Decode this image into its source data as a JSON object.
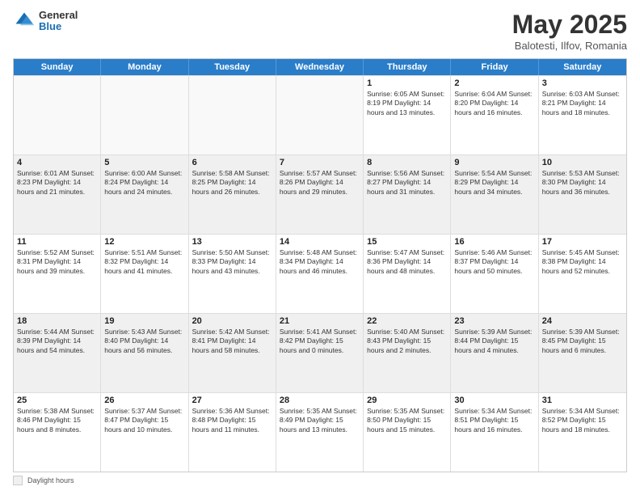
{
  "header": {
    "logo_general": "General",
    "logo_blue": "Blue",
    "month_title": "May 2025",
    "location": "Balotesti, Ilfov, Romania"
  },
  "weekdays": [
    "Sunday",
    "Monday",
    "Tuesday",
    "Wednesday",
    "Thursday",
    "Friday",
    "Saturday"
  ],
  "footer": {
    "label": "Daylight hours"
  },
  "rows": [
    [
      {
        "day": "",
        "info": "",
        "empty": true
      },
      {
        "day": "",
        "info": "",
        "empty": true
      },
      {
        "day": "",
        "info": "",
        "empty": true
      },
      {
        "day": "",
        "info": "",
        "empty": true
      },
      {
        "day": "1",
        "info": "Sunrise: 6:05 AM\nSunset: 8:19 PM\nDaylight: 14 hours\nand 13 minutes."
      },
      {
        "day": "2",
        "info": "Sunrise: 6:04 AM\nSunset: 8:20 PM\nDaylight: 14 hours\nand 16 minutes."
      },
      {
        "day": "3",
        "info": "Sunrise: 6:03 AM\nSunset: 8:21 PM\nDaylight: 14 hours\nand 18 minutes."
      }
    ],
    [
      {
        "day": "4",
        "info": "Sunrise: 6:01 AM\nSunset: 8:23 PM\nDaylight: 14 hours\nand 21 minutes."
      },
      {
        "day": "5",
        "info": "Sunrise: 6:00 AM\nSunset: 8:24 PM\nDaylight: 14 hours\nand 24 minutes."
      },
      {
        "day": "6",
        "info": "Sunrise: 5:58 AM\nSunset: 8:25 PM\nDaylight: 14 hours\nand 26 minutes."
      },
      {
        "day": "7",
        "info": "Sunrise: 5:57 AM\nSunset: 8:26 PM\nDaylight: 14 hours\nand 29 minutes."
      },
      {
        "day": "8",
        "info": "Sunrise: 5:56 AM\nSunset: 8:27 PM\nDaylight: 14 hours\nand 31 minutes."
      },
      {
        "day": "9",
        "info": "Sunrise: 5:54 AM\nSunset: 8:29 PM\nDaylight: 14 hours\nand 34 minutes."
      },
      {
        "day": "10",
        "info": "Sunrise: 5:53 AM\nSunset: 8:30 PM\nDaylight: 14 hours\nand 36 minutes."
      }
    ],
    [
      {
        "day": "11",
        "info": "Sunrise: 5:52 AM\nSunset: 8:31 PM\nDaylight: 14 hours\nand 39 minutes."
      },
      {
        "day": "12",
        "info": "Sunrise: 5:51 AM\nSunset: 8:32 PM\nDaylight: 14 hours\nand 41 minutes."
      },
      {
        "day": "13",
        "info": "Sunrise: 5:50 AM\nSunset: 8:33 PM\nDaylight: 14 hours\nand 43 minutes."
      },
      {
        "day": "14",
        "info": "Sunrise: 5:48 AM\nSunset: 8:34 PM\nDaylight: 14 hours\nand 46 minutes."
      },
      {
        "day": "15",
        "info": "Sunrise: 5:47 AM\nSunset: 8:36 PM\nDaylight: 14 hours\nand 48 minutes."
      },
      {
        "day": "16",
        "info": "Sunrise: 5:46 AM\nSunset: 8:37 PM\nDaylight: 14 hours\nand 50 minutes."
      },
      {
        "day": "17",
        "info": "Sunrise: 5:45 AM\nSunset: 8:38 PM\nDaylight: 14 hours\nand 52 minutes."
      }
    ],
    [
      {
        "day": "18",
        "info": "Sunrise: 5:44 AM\nSunset: 8:39 PM\nDaylight: 14 hours\nand 54 minutes."
      },
      {
        "day": "19",
        "info": "Sunrise: 5:43 AM\nSunset: 8:40 PM\nDaylight: 14 hours\nand 56 minutes."
      },
      {
        "day": "20",
        "info": "Sunrise: 5:42 AM\nSunset: 8:41 PM\nDaylight: 14 hours\nand 58 minutes."
      },
      {
        "day": "21",
        "info": "Sunrise: 5:41 AM\nSunset: 8:42 PM\nDaylight: 15 hours\nand 0 minutes."
      },
      {
        "day": "22",
        "info": "Sunrise: 5:40 AM\nSunset: 8:43 PM\nDaylight: 15 hours\nand 2 minutes."
      },
      {
        "day": "23",
        "info": "Sunrise: 5:39 AM\nSunset: 8:44 PM\nDaylight: 15 hours\nand 4 minutes."
      },
      {
        "day": "24",
        "info": "Sunrise: 5:39 AM\nSunset: 8:45 PM\nDaylight: 15 hours\nand 6 minutes."
      }
    ],
    [
      {
        "day": "25",
        "info": "Sunrise: 5:38 AM\nSunset: 8:46 PM\nDaylight: 15 hours\nand 8 minutes."
      },
      {
        "day": "26",
        "info": "Sunrise: 5:37 AM\nSunset: 8:47 PM\nDaylight: 15 hours\nand 10 minutes."
      },
      {
        "day": "27",
        "info": "Sunrise: 5:36 AM\nSunset: 8:48 PM\nDaylight: 15 hours\nand 11 minutes."
      },
      {
        "day": "28",
        "info": "Sunrise: 5:35 AM\nSunset: 8:49 PM\nDaylight: 15 hours\nand 13 minutes."
      },
      {
        "day": "29",
        "info": "Sunrise: 5:35 AM\nSunset: 8:50 PM\nDaylight: 15 hours\nand 15 minutes."
      },
      {
        "day": "30",
        "info": "Sunrise: 5:34 AM\nSunset: 8:51 PM\nDaylight: 15 hours\nand 16 minutes."
      },
      {
        "day": "31",
        "info": "Sunrise: 5:34 AM\nSunset: 8:52 PM\nDaylight: 15 hours\nand 18 minutes."
      }
    ]
  ]
}
